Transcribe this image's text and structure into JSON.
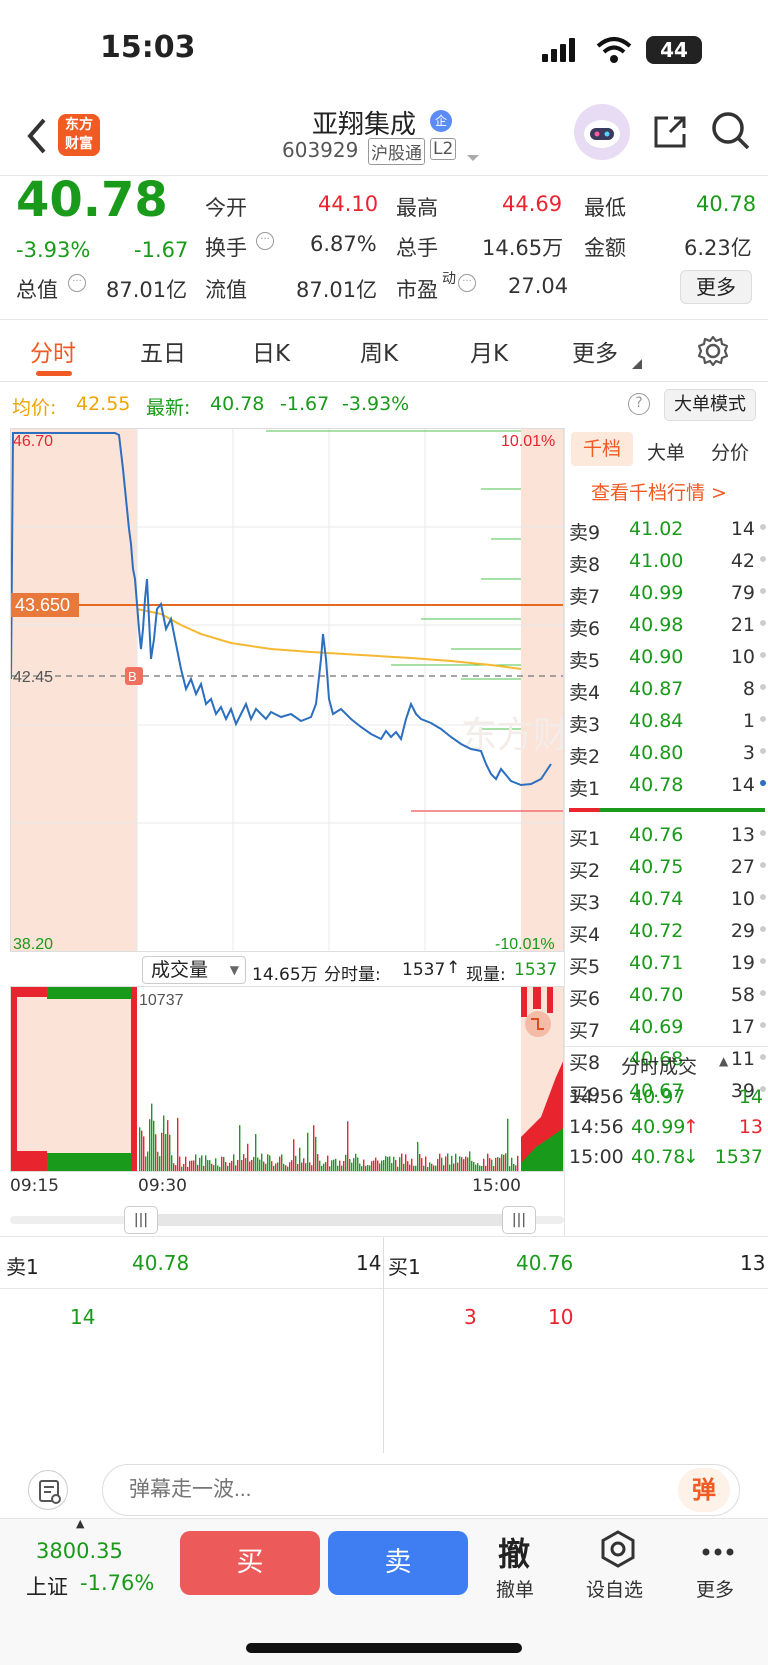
{
  "status": {
    "time": "15:03",
    "battery": "44"
  },
  "nav": {
    "title": "亚翔集成",
    "code": "603929",
    "tag1": "沪股通",
    "tag2": "L2",
    "logo": "东方财富",
    "badge": "企"
  },
  "quote": {
    "price": "40.78",
    "pct": "-3.93%",
    "chg": "-1.67",
    "open_label": "今开",
    "open": "44.10",
    "high_label": "最高",
    "high": "44.69",
    "low_label": "最低",
    "low": "40.78",
    "turnover_label": "换手",
    "turnover": "6.87%",
    "vol_label": "总手",
    "vol": "14.65万",
    "amount_label": "金额",
    "amount": "6.23亿",
    "mktcap_label": "总值",
    "mktcap": "87.01亿",
    "float_label": "流值",
    "float": "87.01亿",
    "pe_label": "市盈",
    "pe_sup": "动",
    "pe": "27.04",
    "more": "更多"
  },
  "tabs": [
    "分时",
    "五日",
    "日K",
    "周K",
    "月K",
    "更多"
  ],
  "infobar": {
    "avg_label": "均价:",
    "avg": "42.55",
    "last_label": "最新:",
    "last": "40.78",
    "chg": "-1.67",
    "pct": "-3.93%",
    "mode": "大单模式"
  },
  "chart": {
    "top": "46.70",
    "bottom": "38.20",
    "top_pct": "10.01%",
    "bottom_pct": "-10.01%",
    "hline": "43.650",
    "dash": "42.45",
    "marker": "B",
    "watermark": "东方财富"
  },
  "volume": {
    "selector": "成交量",
    "total": "14.65万",
    "min_label": "分时量:",
    "min_val": "1537",
    "now_label": "现量:",
    "now_val": "1537",
    "max": "10737"
  },
  "time_axis": [
    "09:15",
    "09:30",
    "15:00"
  ],
  "book": {
    "tabs": [
      "千档",
      "大单",
      "分价"
    ],
    "link": "查看千档行情 >",
    "asks": [
      {
        "label": "卖9",
        "price": "41.02",
        "vol": "14"
      },
      {
        "label": "卖8",
        "price": "41.00",
        "vol": "42"
      },
      {
        "label": "卖7",
        "price": "40.99",
        "vol": "79"
      },
      {
        "label": "卖6",
        "price": "40.98",
        "vol": "21"
      },
      {
        "label": "卖5",
        "price": "40.90",
        "vol": "10"
      },
      {
        "label": "卖4",
        "price": "40.87",
        "vol": "8"
      },
      {
        "label": "卖3",
        "price": "40.84",
        "vol": "1"
      },
      {
        "label": "卖2",
        "price": "40.80",
        "vol": "3"
      },
      {
        "label": "卖1",
        "price": "40.78",
        "vol": "14"
      }
    ],
    "bids": [
      {
        "label": "买1",
        "price": "40.76",
        "vol": "13"
      },
      {
        "label": "买2",
        "price": "40.75",
        "vol": "27"
      },
      {
        "label": "买3",
        "price": "40.74",
        "vol": "10"
      },
      {
        "label": "买4",
        "price": "40.72",
        "vol": "29"
      },
      {
        "label": "买5",
        "price": "40.71",
        "vol": "19"
      },
      {
        "label": "买6",
        "price": "40.70",
        "vol": "58"
      },
      {
        "label": "买7",
        "price": "40.69",
        "vol": "17"
      },
      {
        "label": "买8",
        "price": "40.68",
        "vol": "11"
      },
      {
        "label": "买9",
        "price": "40.67",
        "vol": "39"
      }
    ],
    "trades_title": "分时成交",
    "trades": [
      {
        "time": "14:56",
        "price": "40.97",
        "arrow": "",
        "vol": "14"
      },
      {
        "time": "14:56",
        "price": "40.99",
        "arrow": "↑",
        "vol": "13"
      },
      {
        "time": "15:00",
        "price": "40.78",
        "arrow": "↓",
        "vol": "1537"
      }
    ]
  },
  "l2": {
    "sell_label": "卖1",
    "sell_price": "40.78",
    "sell_vol": "14",
    "buy_label": "买1",
    "buy_price": "40.76",
    "buy_vol": "13",
    "sell_q1": "14",
    "buy_q1": "3",
    "buy_q2": "10"
  },
  "danmu": {
    "placeholder": "弹幕走一波...",
    "btn": "弹"
  },
  "bottom": {
    "index_val": "3800.35",
    "index_name": "上证",
    "index_pct": "-1.76%",
    "buy": "买",
    "sell": "卖",
    "cancel_icon": "撤",
    "cancel": "撤单",
    "watch": "设自选",
    "more": "更多"
  }
}
